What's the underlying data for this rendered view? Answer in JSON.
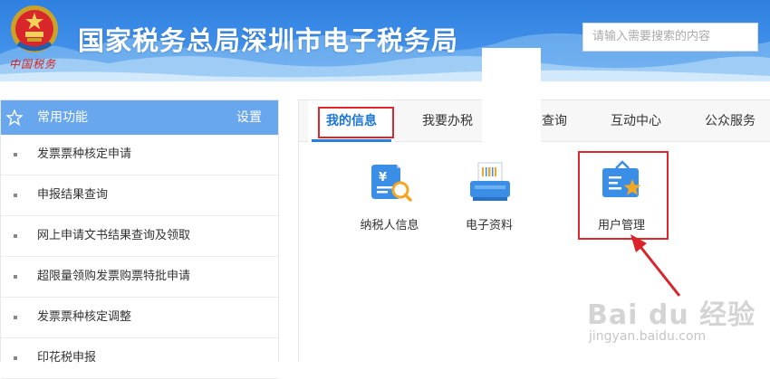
{
  "header": {
    "title": "国家税务总局深圳市电子税务局",
    "emblem_caption": "中国税务",
    "search_placeholder": "请输入需要搜索的内容"
  },
  "sidebar": {
    "title": "常用功能",
    "settings_label": "设置",
    "items": [
      {
        "label": "发票票种核定申请"
      },
      {
        "label": "申报结果查询"
      },
      {
        "label": "网上申请文书结果查询及领取"
      },
      {
        "label": "超限量领购发票购票特批申请"
      },
      {
        "label": "发票票种核定调整"
      },
      {
        "label": "印花税申报"
      }
    ]
  },
  "tabs": [
    {
      "label": "我的信息",
      "active": true
    },
    {
      "label": "我要办税",
      "active": false
    },
    {
      "label": "我要查询",
      "active": false
    },
    {
      "label": "互动中心",
      "active": false
    },
    {
      "label": "公众服务",
      "active": false
    }
  ],
  "tiles": [
    {
      "label": "纳税人信息",
      "icon": "taxpayer-info-icon"
    },
    {
      "label": "电子资料",
      "icon": "printer-icon"
    },
    {
      "label": "用户管理",
      "icon": "user-management-icon"
    }
  ],
  "watermark": {
    "logo": "Bai du 经验",
    "url": "jingyan.baidu.com"
  },
  "colors": {
    "header_blue": "#3f8fe9",
    "sidebar_head": "#68a6ed",
    "active_tab": "#1a73d9",
    "highlight_red": "#e0262b",
    "icon_blue": "#3a8ee6",
    "icon_orange": "#f5a623"
  }
}
